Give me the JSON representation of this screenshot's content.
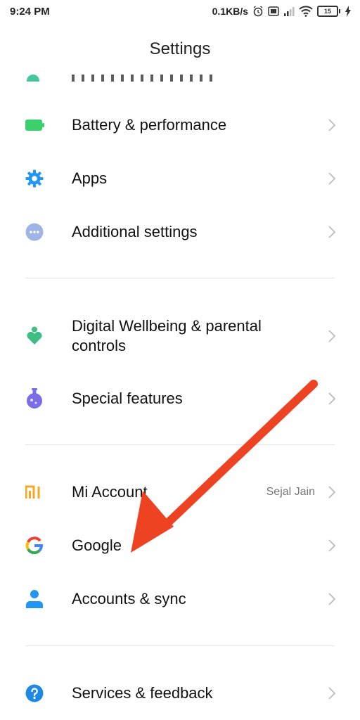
{
  "status": {
    "time": "9:24 PM",
    "network_speed": "0.1KB/s",
    "battery_level": "15"
  },
  "header": {
    "title": "Settings"
  },
  "items": [
    {
      "label": "Battery & performance",
      "icon": "battery-icon"
    },
    {
      "label": "Apps",
      "icon": "gear-icon"
    },
    {
      "label": "Additional settings",
      "icon": "more-dots-icon"
    },
    {
      "label_line1": "Digital Wellbeing & parental",
      "label_line2": "controls",
      "icon": "wellbeing-heart-icon"
    },
    {
      "label": "Special features",
      "icon": "flask-icon"
    },
    {
      "label": "Mi Account",
      "value": "Sejal Jain",
      "icon": "mi-logo-icon"
    },
    {
      "label": "Google",
      "icon": "google-icon"
    },
    {
      "label": "Accounts & sync",
      "icon": "person-icon"
    },
    {
      "label": "Services & feedback",
      "icon": "help-icon"
    }
  ],
  "colors": {
    "battery": "#3ccf6e",
    "apps": "#2196f3",
    "additional": "#9eb4e6",
    "wellbeing": "#3fbe84",
    "special": "#7b6ce8",
    "mi": "#f5a623",
    "accounts": "#2196f3",
    "help": "#1e88e5",
    "annotation_arrow": "#ee4323"
  }
}
